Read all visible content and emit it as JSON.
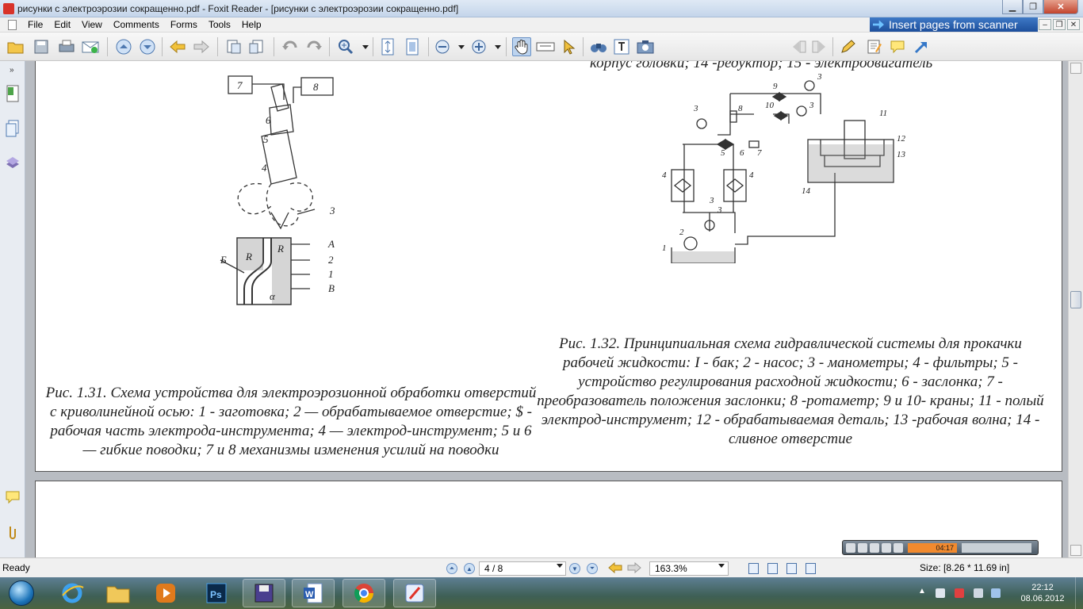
{
  "window": {
    "title": "рисунки с электроэрозии сокращенно.pdf - Foxit Reader - [рисунки с электроэрозии сокращенно.pdf]"
  },
  "menu": [
    "File",
    "Edit",
    "View",
    "Comments",
    "Forms",
    "Tools",
    "Help"
  ],
  "scanner_banner": "Insert pages from scanner",
  "toolbar": {
    "find_placeholder": "Find",
    "icons": [
      "open-icon",
      "save-icon",
      "print-icon",
      "email-icon",
      "page-up-icon",
      "page-down-icon",
      "back-icon",
      "forward-icon",
      "extract-icon",
      "insert-icon",
      "undo-icon",
      "redo-icon",
      "zoom-in-icon",
      "fit-page-icon",
      "fit-width-icon",
      "zoom-out-icon",
      "zoom-plus-icon",
      "hand-icon",
      "text-select-icon",
      "select-icon",
      "binoculars-icon",
      "typewriter-icon",
      "snapshot-icon",
      "find-prev-icon",
      "find-next-icon",
      "pencil-icon",
      "note-icon",
      "comment-icon",
      "arrow-icon"
    ]
  },
  "document": {
    "top_caption": "корпус головки; 14 -редуктор; 15 - электродвигатель",
    "fig31": {
      "caption": "Рис. 1.31. Схема устройства для электроэрозионной обработки отверстий с криволинейной осью: 1 - заготовка; 2 — обрабатываемое отверстие; $ - рабочая часть электрода-инструмента; 4 — электрод-инструмент; 5 и 6 — гибкие поводки; 7 и 8 механизмы изменения усилий на поводки",
      "labels": [
        "7",
        "8",
        "6",
        "5",
        "4",
        "3",
        "A",
        "2",
        "1",
        "B",
        "Б",
        "R",
        "R",
        "α"
      ]
    },
    "fig32": {
      "caption": "Рис. 1.32. Принципиальная схема гидравлической системы для прокачки рабочей жидкости: I - бак; 2 - насос; 3 - манометры; 4 - фильтры; 5 - устройство регулирования расходной жидкости; 6 - заслонка; 7 - преобразователь положения заслонки; 8 -ротаметр; 9 и 10- краны; 11 - полый электрод-инструмент; 12 - обрабатываемая деталь; 13 -рабочая волна; 14 - сливное отверстие",
      "labels": [
        "3",
        "9",
        "3",
        "10",
        "3",
        "3",
        "8",
        "11",
        "12",
        "13",
        "5",
        "6",
        "7",
        "4",
        "4",
        "14",
        "3",
        "2",
        "1"
      ]
    }
  },
  "media": {
    "lcd": "04:17"
  },
  "status": {
    "ready": "Ready",
    "page": "4 / 8",
    "zoom": "163.3%",
    "size": "Size: [8.26 * 11.69 in]"
  },
  "taskbar": {
    "apps": [
      "internet-explorer-icon",
      "explorer-icon",
      "media-player-icon",
      "photoshop-icon",
      "save-disk-icon",
      "word-icon",
      "chrome-icon",
      "foxit-icon"
    ],
    "time": "22:12",
    "date": "08.06.2012"
  }
}
